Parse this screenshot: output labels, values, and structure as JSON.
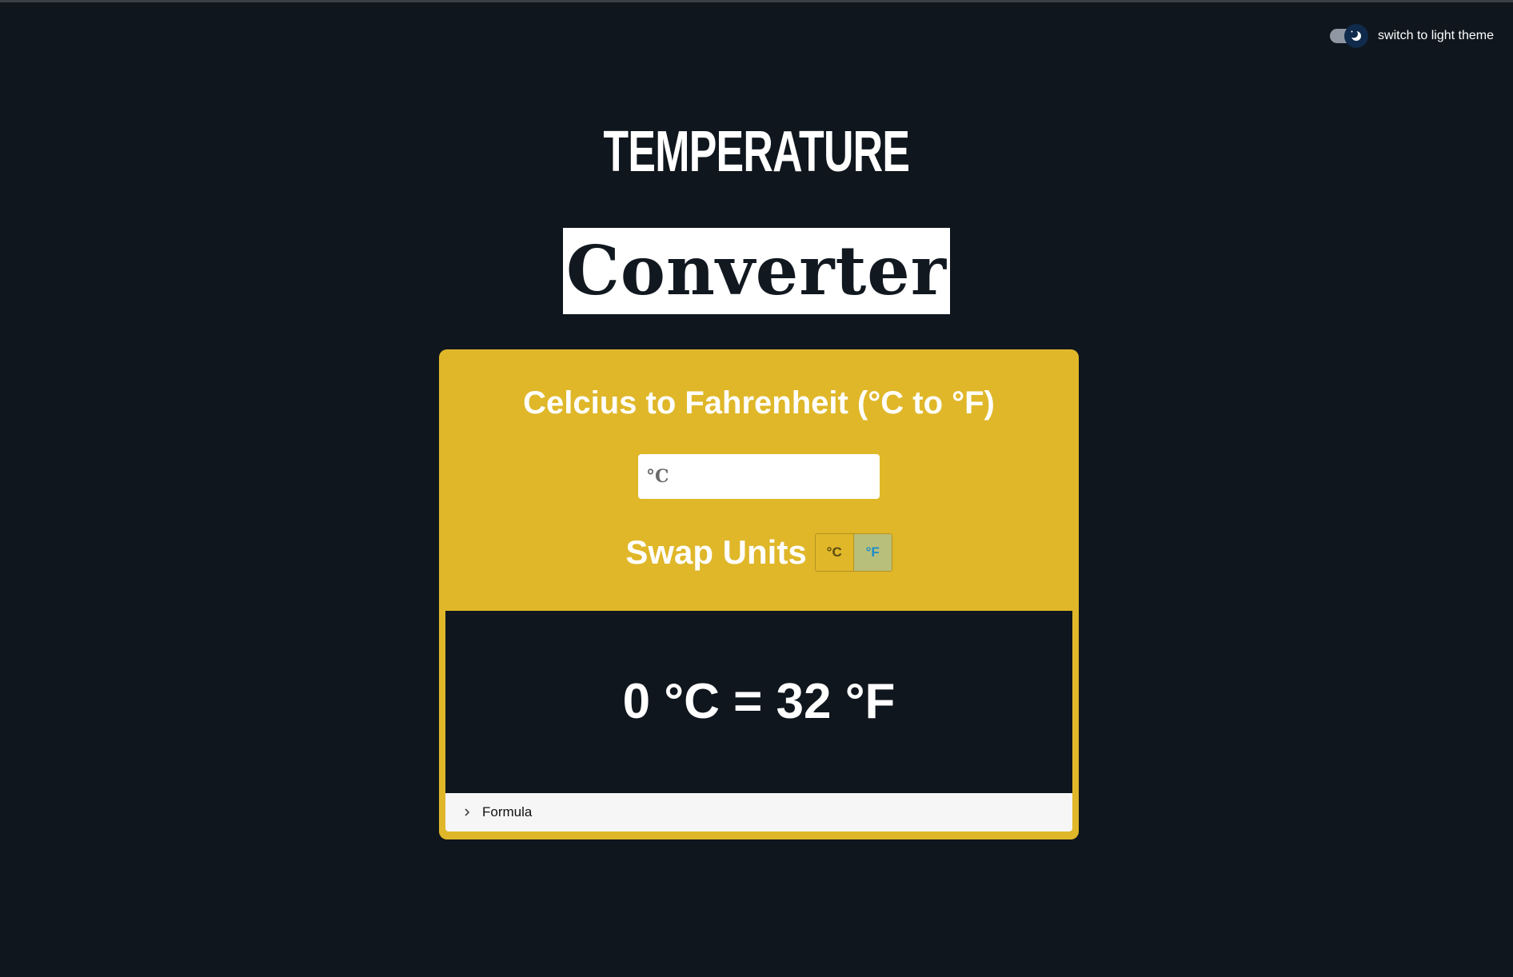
{
  "theme_toggle": {
    "label": "switch to light theme",
    "icon": "moon-icon"
  },
  "title": {
    "top": "TEMPERATURE",
    "bottom": "Converter"
  },
  "converter": {
    "heading": "Celcius to Fahrenheit (°C to °F)",
    "input_placeholder": "°C",
    "input_value": "",
    "swap_label": "Swap Units",
    "swap_options": [
      "°C",
      "°F"
    ],
    "active_option": "°F",
    "result": "0 °C = 32 °F",
    "formula_label": "Formula",
    "formula_icon": "chevron-right-icon"
  },
  "colors": {
    "background": "#10161d",
    "accent": "#dfb729",
    "result_panel": "#10161d",
    "formula_bg": "#f6f6f6",
    "fahrenheit_text": "#1d8ec9"
  }
}
